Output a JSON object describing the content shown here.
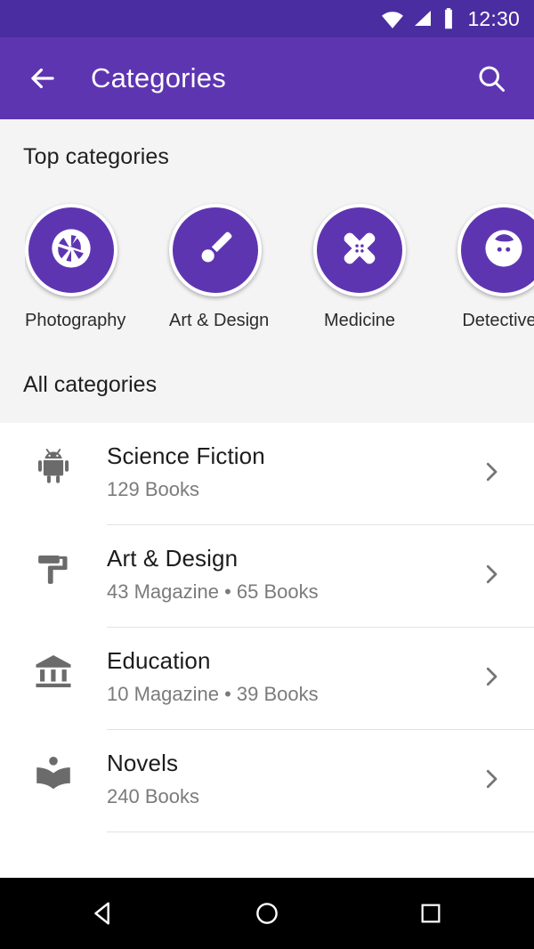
{
  "status_bar": {
    "wifi_icon": "wifi-icon",
    "signal_icon": "cellular-signal-icon",
    "battery_icon": "battery-icon",
    "clock": "12:30",
    "background": "#4A2DA0"
  },
  "app_bar": {
    "back_icon": "arrow-back-icon",
    "title": "Categories",
    "search_icon": "search-icon",
    "background": "#5E35B1"
  },
  "top_section": {
    "title": "Top categories",
    "items": [
      {
        "label": "Photography",
        "icon": "camera-aperture-icon"
      },
      {
        "label": "Art & Design",
        "icon": "paintbrush-icon"
      },
      {
        "label": "Medicine",
        "icon": "crossed-bandages-icon"
      },
      {
        "label": "Detectives",
        "icon": "face-icon"
      }
    ],
    "circle_color": "#5E35B1",
    "background": "#F4F4F4"
  },
  "all_section": {
    "title": "All categories",
    "chevron_icon": "chevron-right-icon",
    "rows": [
      {
        "title": "Science Fiction",
        "subtitle": "129 Books",
        "icon": "android-robot-icon"
      },
      {
        "title": "Art & Design",
        "subtitle": "43 Magazine • 65 Books",
        "icon": "paint-roller-icon"
      },
      {
        "title": "Education",
        "subtitle": "10 Magazine • 39 Books",
        "icon": "bank-columns-icon"
      },
      {
        "title": "Novels",
        "subtitle": "240 Books",
        "icon": "open-book-icon"
      }
    ]
  },
  "nav_bar": {
    "back_icon": "nav-back-triangle-icon",
    "home_icon": "nav-home-circle-icon",
    "recents_icon": "nav-recents-square-icon",
    "background": "#000000"
  }
}
